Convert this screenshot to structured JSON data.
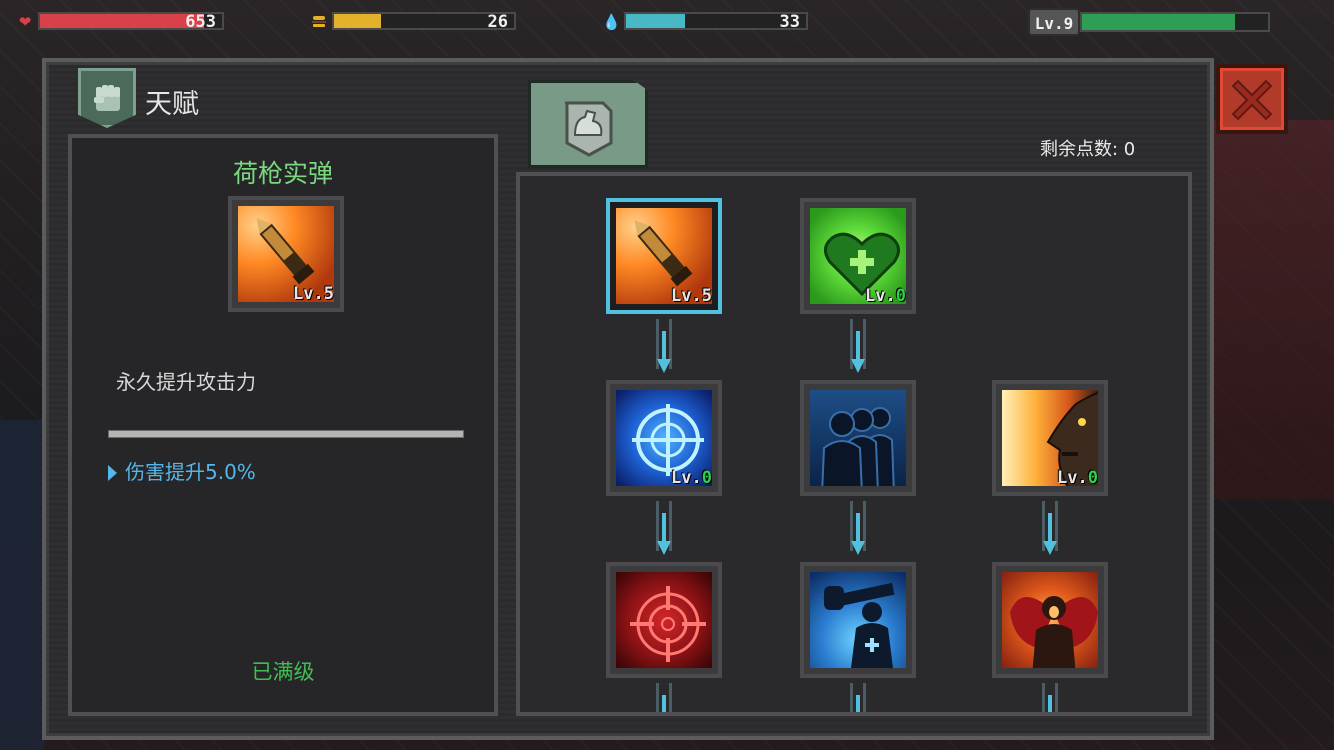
{
  "hud": {
    "health": {
      "value": "653",
      "fill": 0.9,
      "color": "#d9414a",
      "icon": "heart-icon"
    },
    "food": {
      "value": "26",
      "fill": 0.26,
      "color": "#e3b22a",
      "icon": "burger-icon"
    },
    "water": {
      "value": "33",
      "fill": 0.33,
      "color": "#47b8c6",
      "icon": "water-drop-icon"
    },
    "level": {
      "label": "Lv.9",
      "fill": 0.82,
      "color": "#2f9e55"
    }
  },
  "panel": {
    "title": "天赋",
    "icon": "fist-icon",
    "remaining_points": "剩余点数: 0",
    "tab_icon": "flexed-arm-icon",
    "close_icon": "close-icon"
  },
  "detail": {
    "name": "荷枪实弹",
    "icon_level": "Lv.5",
    "description": "永久提升攻击力",
    "effect": "伤害提升5.0%",
    "status": "已满级"
  },
  "tree": {
    "nodes": [
      {
        "icon": "bullet-icon",
        "level_prefix": "Lv.",
        "level_num": "5",
        "selected": true
      },
      {
        "icon": "heart-plus-icon",
        "level_prefix": "Lv.",
        "level_num": "0",
        "selected": false
      },
      {
        "icon": "crosshair-blue-icon",
        "level_prefix": "Lv.",
        "level_num": "0",
        "selected": false
      },
      {
        "icon": "shadow-figures-icon",
        "level_prefix": "",
        "level_num": "",
        "selected": false
      },
      {
        "icon": "rage-face-icon",
        "level_prefix": "Lv.",
        "level_num": "0",
        "selected": false
      },
      {
        "icon": "crosshair-red-icon",
        "level_prefix": "",
        "level_num": "",
        "selected": false
      },
      {
        "icon": "heavy-gunner-icon",
        "level_prefix": "",
        "level_num": "",
        "selected": false
      },
      {
        "icon": "demon-wings-icon",
        "level_prefix": "",
        "level_num": "",
        "selected": false
      }
    ]
  }
}
